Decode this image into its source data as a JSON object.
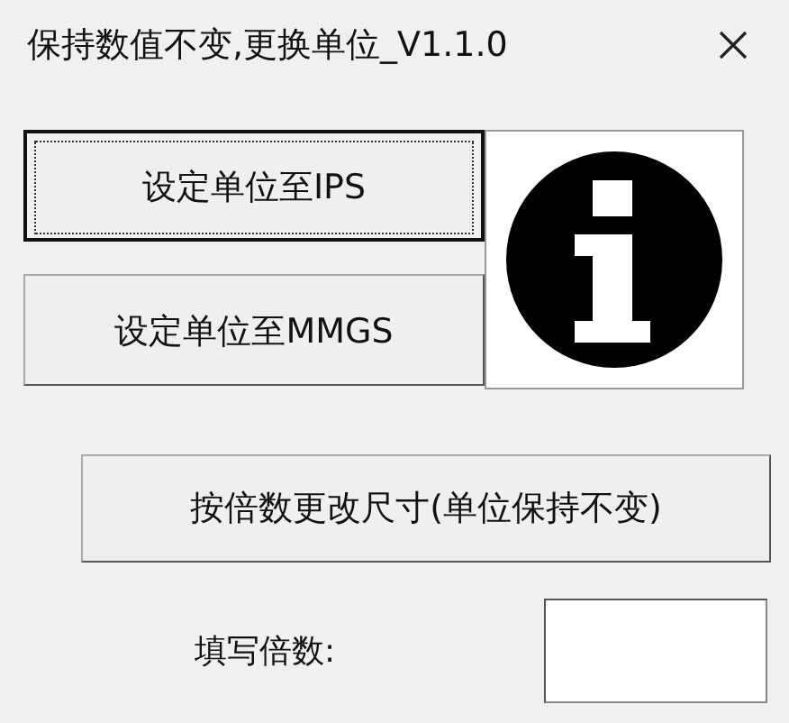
{
  "window": {
    "title": "保持数值不变,更换单位_V1.1.0"
  },
  "unit_buttons": [
    {
      "label": "设定单位至IPS",
      "focused": true
    },
    {
      "label": "设定单位至MMGS",
      "focused": false
    }
  ],
  "scale_button": {
    "label": "按倍数更改尺寸(单位保持不变)"
  },
  "scale_field": {
    "label": "填写倍数:"
  }
}
